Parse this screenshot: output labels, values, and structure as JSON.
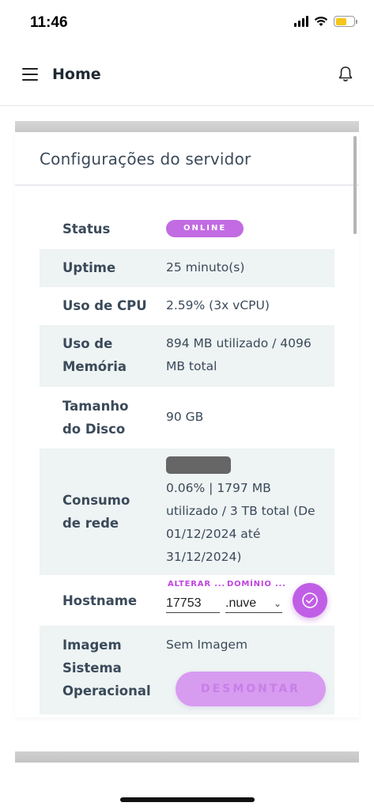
{
  "status_bar": {
    "time": "11:46"
  },
  "header": {
    "title": "Home"
  },
  "card": {
    "title": "Configurações do servidor"
  },
  "rows": {
    "status": {
      "label": "Status",
      "badge": "ONLINE"
    },
    "uptime": {
      "label": "Uptime",
      "value": "25 minuto(s)"
    },
    "cpu": {
      "label": "Uso de CPU",
      "value": "2.59% (3x vCPU)"
    },
    "memory": {
      "label_line1": "Uso de",
      "label_line2": "Memória",
      "value_line1": "894 MB utilizado / 4096",
      "value_line2": "MB total"
    },
    "disk": {
      "label_line1": "Tamanho",
      "label_line2": "do Disco",
      "value": "90 GB"
    },
    "network": {
      "label_line1": "Consumo",
      "label_line2": "de rede",
      "value_lines": [
        "0.06% | 1797 MB",
        "utilizado / 3 TB total (De",
        "01/12/2024 até",
        "31/12/2024)"
      ]
    },
    "hostname": {
      "label": "Hostname",
      "field1_label": "ALTERAR ...",
      "field1_value": "17753",
      "field2_label": "DOMÍNIO ...",
      "field2_value": ".nuve"
    },
    "image": {
      "label_line1": "Imagem",
      "label_line2": "Sistema",
      "label_line3": "Operacional",
      "value": "Sem Imagem",
      "button": "DESMONTAR"
    }
  },
  "colors": {
    "accent": "#c15ee6",
    "badge": "#c26be3",
    "row_alt": "#eef3f3"
  }
}
